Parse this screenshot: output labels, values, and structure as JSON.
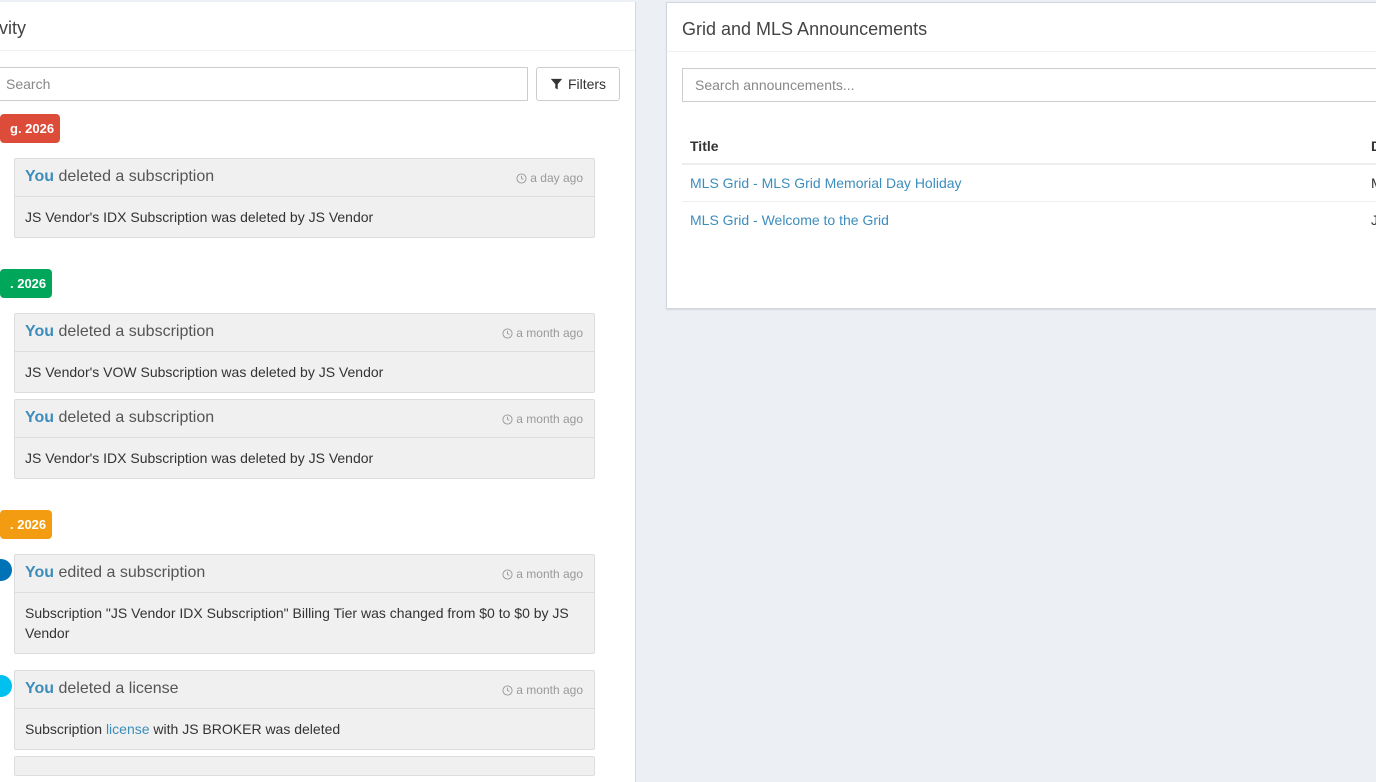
{
  "activity": {
    "title": "tivity",
    "search_placeholder": "Search",
    "filters_label": "Filters",
    "groups": [
      {
        "date": "g. 2026",
        "color": "#dd4b39"
      },
      {
        "date": ". 2026",
        "color": "#00a65a"
      },
      {
        "date": ". 2026",
        "color": "#f39c12"
      }
    ],
    "items": [
      {
        "you": "You",
        "action": "deleted a subscription",
        "time": "a day ago",
        "body": "JS Vendor's IDX Subscription was deleted by JS Vendor"
      },
      {
        "you": "You",
        "action": "deleted a subscription",
        "time": "a month ago",
        "body": "JS Vendor's VOW Subscription was deleted by JS Vendor"
      },
      {
        "you": "You",
        "action": "deleted a subscription",
        "time": "a month ago",
        "body": "JS Vendor's IDX Subscription was deleted by JS Vendor"
      },
      {
        "you": "You",
        "action": "edited a subscription",
        "time": "a month ago",
        "body": "Subscription \"JS Vendor IDX Subscription\" Billing Tier was changed from $0 to $0 by JS Vendor"
      },
      {
        "you": "You",
        "action": "deleted a license",
        "time": "a month ago",
        "body_pre": "Subscription ",
        "body_link": "license",
        "body_post": " with JS BROKER was deleted"
      }
    ],
    "dot_colors": [
      "#0073b7",
      "#00c0ef"
    ]
  },
  "announcements": {
    "title": "Grid and MLS Announcements",
    "search_placeholder": "Search announcements...",
    "col_title": "Title",
    "col_date": "D",
    "rows": [
      {
        "title": "MLS Grid - MLS Grid Memorial Day Holiday",
        "date": "M"
      },
      {
        "title": "MLS Grid - Welcome to the Grid",
        "date": "J"
      }
    ]
  }
}
